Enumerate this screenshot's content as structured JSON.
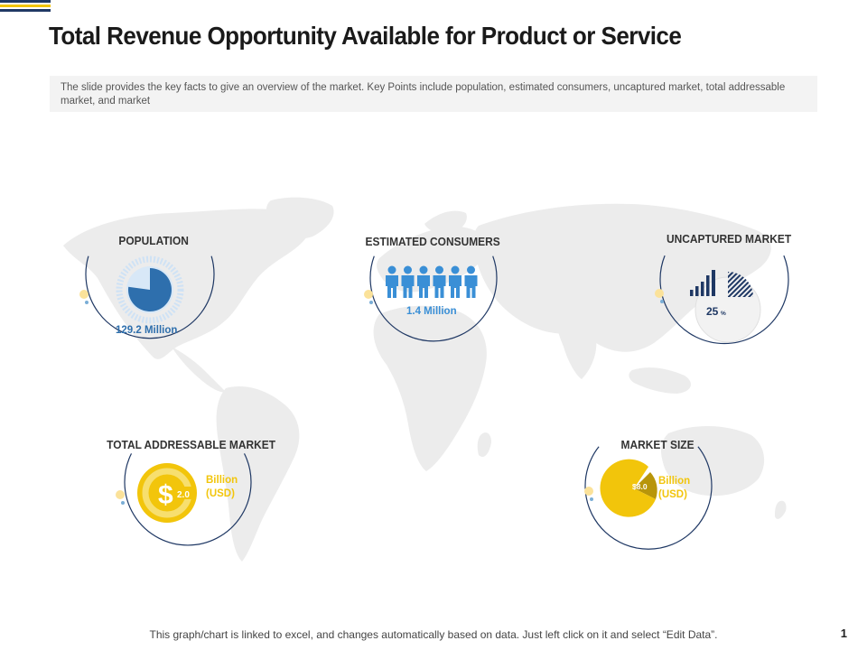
{
  "title": "Total Revenue Opportunity Available for Product or Service",
  "subtitle": "The slide provides the key facts to give  an overview of the market. Key Points include population, estimated consumers, uncaptured market, total addressable market, and market",
  "cards": {
    "population": {
      "label": "POPULATION",
      "value": "129.2 Million"
    },
    "consumers": {
      "label": "ESTIMATED CONSUMERS",
      "value": "1.4 Million"
    },
    "uncaptured": {
      "label": "UNCAPTURED MARKET",
      "value": "25",
      "unit": "%"
    },
    "tam": {
      "label": "TOTAL ADDRESSABLE MARKET",
      "value": "2.0",
      "unit_line1": "Billion",
      "unit_line2": "(USD)"
    },
    "market_size": {
      "label": "MARKET SIZE",
      "value": "$8.0",
      "unit_line1": "Billion",
      "unit_line2": "(USD)"
    }
  },
  "footer": "This graph/chart is linked to excel, and changes automatically based on data. Just left click on it and select “Edit Data”.",
  "page_number": "1",
  "colors": {
    "navy": "#1f3864",
    "blue": "#2e6fad",
    "light_blue": "#3a8fd6",
    "yellow": "#f2c50b",
    "olive": "#b8950a",
    "map": "#ececec"
  },
  "icons": [
    "person-icon",
    "dollar-icon",
    "bar-chart-icon",
    "pie-chart-icon"
  ]
}
